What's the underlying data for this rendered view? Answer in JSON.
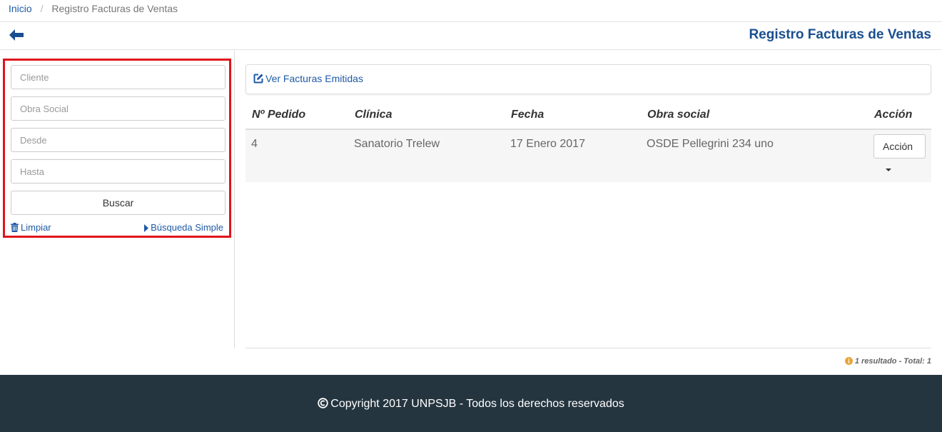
{
  "breadcrumb": {
    "home": "Inicio",
    "separator": "/",
    "current": "Registro Facturas de Ventas"
  },
  "header": {
    "title": "Registro Facturas de Ventas"
  },
  "search": {
    "cliente_placeholder": "Cliente",
    "obra_social_placeholder": "Obra Social",
    "desde_placeholder": "Desde",
    "hasta_placeholder": "Hasta",
    "buscar_label": "Buscar",
    "limpiar_label": "Limpiar",
    "busqueda_simple_label": "Búsqueda Simple"
  },
  "panel": {
    "ver_facturas_label": "Ver Facturas Emitidas"
  },
  "table": {
    "headers": [
      "Nº Pedido",
      "Clínica",
      "Fecha",
      "Obra social",
      "Acción"
    ],
    "rows": [
      {
        "pedido": "4",
        "clinica": "Sanatorio Trelew",
        "fecha": "17 Enero 2017",
        "obra_social": "OSDE Pellegrini 234 uno",
        "accion_label": "Acción"
      }
    ]
  },
  "result_count": "1 resultado - Total: 1",
  "footer": {
    "copyright": "Copyright 2017 UNPSJB - Todos los derechos reservados"
  },
  "colors": {
    "accent": "#1f5aa6",
    "title": "#1a4f8f",
    "highlight_border": "#e0141b",
    "footer_bg": "#253540",
    "info_icon": "#e8a43a"
  }
}
